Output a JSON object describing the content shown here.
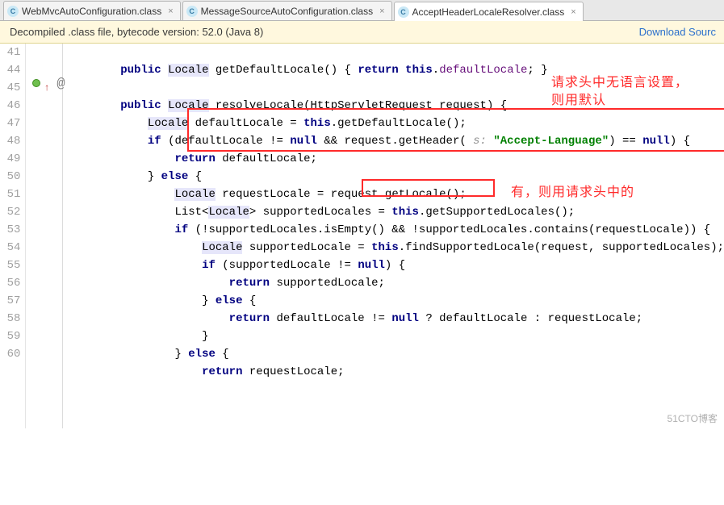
{
  "tabs": [
    {
      "label": "WebMvcAutoConfiguration.class",
      "active": false
    },
    {
      "label": "MessageSourceAutoConfiguration.class",
      "active": false
    },
    {
      "label": "AcceptHeaderLocaleResolver.class",
      "active": true
    }
  ],
  "tab_icon_glyph": "C",
  "close_glyph": "×",
  "banner": {
    "text": "Decompiled .class file, bytecode version: 52.0 (Java 8)",
    "link": "Download Sourc"
  },
  "gutter": {
    "first_line": 41,
    "last_line": 60,
    "at_glyph": "@",
    "up_glyph": "↑"
  },
  "code": {
    "l41_indent": "        ",
    "l41_kw1": "public",
    "l41_sp": " ",
    "l41_typ": "Locale",
    "l41_rest1": " getDefaultLocale() { ",
    "l41_kw2": "return",
    "l41_sp2": " ",
    "l41_kw3": "this",
    "l41_rest2": ".",
    "l41_fld": "defaultLocale",
    "l41_rest3": "; }",
    "l45_indent": "        ",
    "l45_kw1": "public",
    "l45_sp": " ",
    "l45_typ": "Locale",
    "l45_rest": " resolveLocale(HttpServletRequest request) {",
    "l46_indent": "            ",
    "l46_typ": "Locale",
    "l46_rest1": " defaultLocale = ",
    "l46_kw": "this",
    "l46_rest2": ".getDefaultLocale();",
    "l47_indent": "            ",
    "l47_kw1": "if",
    "l47_rest1": " (defaultLocale != ",
    "l47_kw2": "null",
    "l47_rest2": " && request.getHeader( ",
    "l47_hint": "s:",
    "l47_sp": " ",
    "l47_str": "\"Accept-Language\"",
    "l47_rest3": ") == ",
    "l47_kw3": "null",
    "l47_rest4": ") {",
    "l48_indent": "                ",
    "l48_kw": "return",
    "l48_rest": " defaultLocale;",
    "l49_indent": "            ",
    "l49_rest1": "} ",
    "l49_kw": "else",
    "l49_rest2": " {",
    "l50_indent": "                ",
    "l50_typ": "Locale",
    "l50_rest1": " requestLocale = ",
    "l50_call": "request.getLocale()",
    "l50_rest2": ";",
    "l51_indent": "                List<",
    "l51_typ": "Locale",
    "l51_rest1": "> supportedLocales = ",
    "l51_kw": "this",
    "l51_rest2": ".getSupportedLocales();",
    "l52_indent": "                ",
    "l52_kw": "if",
    "l52_rest": " (!supportedLocales.isEmpty() && !supportedLocales.contains(requestLocale)) {",
    "l53_indent": "                    ",
    "l53_typ": "Locale",
    "l53_rest1": " supportedLocale = ",
    "l53_kw": "this",
    "l53_rest2": ".findSupportedLocale(request, supportedLocales);",
    "l54_indent": "                    ",
    "l54_kw1": "if",
    "l54_rest1": " (supportedLocale != ",
    "l54_kw2": "null",
    "l54_rest2": ") {",
    "l55_indent": "                        ",
    "l55_kw": "return",
    "l55_rest": " supportedLocale;",
    "l56_indent": "                    ",
    "l56_rest1": "} ",
    "l56_kw": "else",
    "l56_rest2": " {",
    "l57_indent": "                        ",
    "l57_kw1": "return",
    "l57_rest1": " defaultLocale != ",
    "l57_kw2": "null",
    "l57_rest2": " ? defaultLocale : requestLocale;",
    "l58_indent": "                    ",
    "l58_rest": "}",
    "l59_indent": "                ",
    "l59_rest1": "} ",
    "l59_kw": "else",
    "l59_rest2": " {",
    "l60_indent": "                    ",
    "l60_kw": "return",
    "l60_rest": " requestLocale;"
  },
  "annotations": {
    "a1": "请求头中无语言设置，\n则用默认",
    "a2": "有，则用请求头中的"
  },
  "watermark": "51CTO博客"
}
